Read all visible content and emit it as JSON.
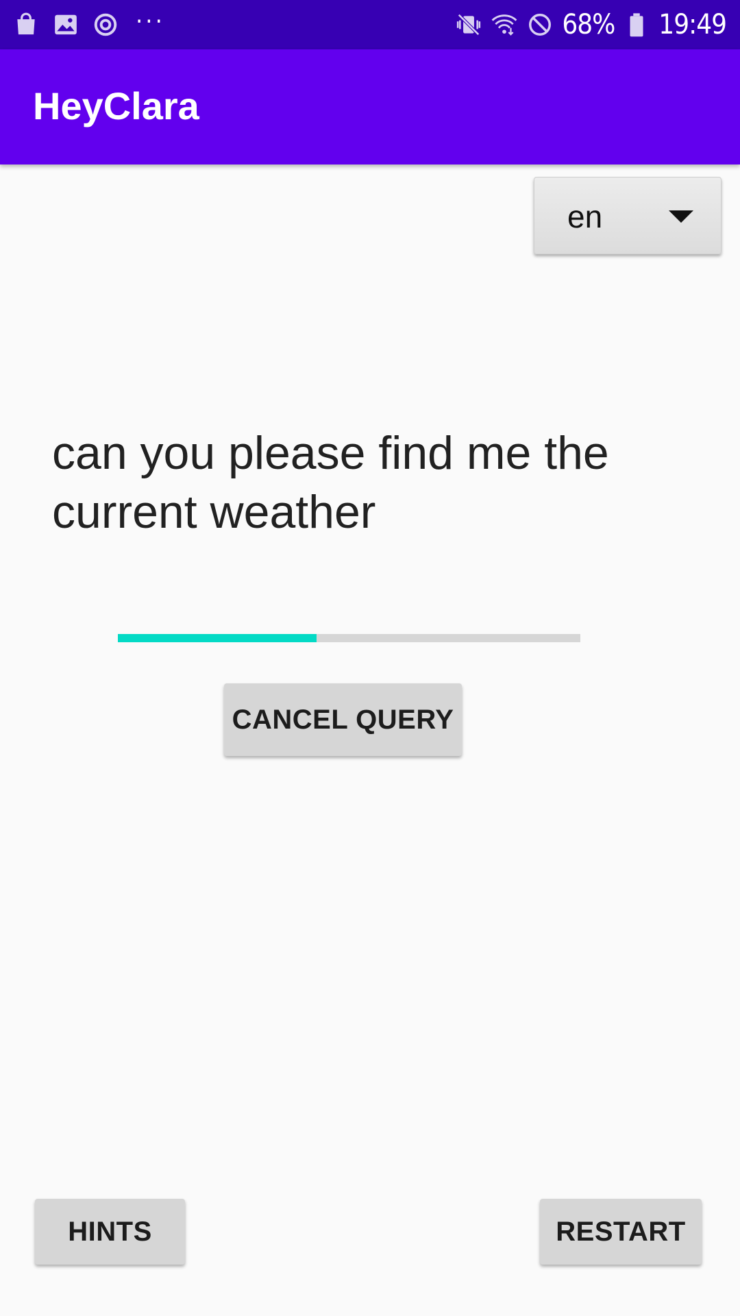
{
  "status_bar": {
    "left_icons": [
      "shopping-bag-icon",
      "gallery-icon",
      "sync-icon",
      "more-dots-icon"
    ],
    "more_dots": "···",
    "right_icons": [
      "vibrate-mute-icon",
      "wifi-icon",
      "do-not-disturb-icon",
      "battery-icon"
    ],
    "battery_percent": "68%",
    "time": "19:49",
    "background": "#3700b3"
  },
  "app_bar": {
    "title": "HeyClara",
    "background": "#6200ee"
  },
  "language_spinner": {
    "selected": "en"
  },
  "query": {
    "text": "can you please find me the current weather"
  },
  "progress": {
    "fraction": 0.43,
    "fill_color": "#03dac5",
    "track_color": "#d6d6d6"
  },
  "buttons": {
    "cancel_query": "CANCEL QUERY",
    "hints": "HINTS",
    "restart": "RESTART"
  }
}
